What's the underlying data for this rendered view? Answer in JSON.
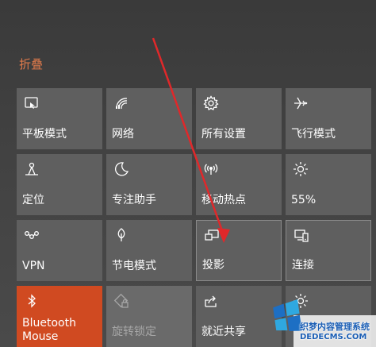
{
  "collapse_label": "折叠",
  "colors": {
    "accent": "#d04a21",
    "collapse_text": "#e07a4b",
    "tile": "#5f5f5f",
    "arrow": "#e0282a"
  },
  "tiles": [
    {
      "label": "平板模式",
      "icon": "tablet-mode-icon"
    },
    {
      "label": "网络",
      "icon": "network-icon"
    },
    {
      "label": "所有设置",
      "icon": "settings-gear-icon"
    },
    {
      "label": "飞行模式",
      "icon": "airplane-icon"
    },
    {
      "label": "定位",
      "icon": "location-icon"
    },
    {
      "label": "专注助手",
      "icon": "moon-icon"
    },
    {
      "label": "移动热点",
      "icon": "hotspot-icon"
    },
    {
      "label": "55%",
      "icon": "brightness-icon"
    },
    {
      "label": "VPN",
      "icon": "vpn-icon"
    },
    {
      "label": "节电模式",
      "icon": "battery-saver-icon"
    },
    {
      "label": "投影",
      "icon": "project-icon"
    },
    {
      "label": "连接",
      "icon": "connect-icon"
    },
    {
      "label": "Bluetooth Mouse",
      "icon": "bluetooth-icon"
    },
    {
      "label": "旋转锁定",
      "icon": "rotation-lock-icon"
    },
    {
      "label": "就近共享",
      "icon": "nearby-share-icon"
    },
    {
      "label": "",
      "icon": "brightness-icon"
    }
  ],
  "watermark": {
    "text": "织梦内容管理系统",
    "url": "DEDECMS.COM"
  }
}
